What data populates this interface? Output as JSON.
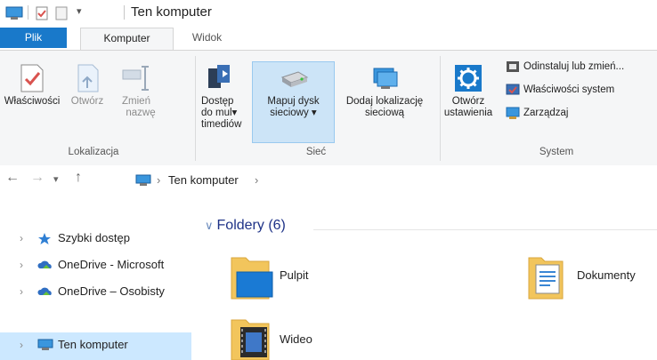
{
  "window": {
    "title": "Ten komputer"
  },
  "tabs": [
    {
      "label": "Plik"
    },
    {
      "label": "Komputer"
    },
    {
      "label": "Widok"
    }
  ],
  "ribbon": {
    "lokalizacja": {
      "group_label": "Lokalizacja",
      "wlasciwosci": "Właściwości",
      "otworz": "Otwórz",
      "zmien_line1": "Zmień",
      "zmien_line2": "nazwę"
    },
    "siec": {
      "group_label": "Sieć",
      "dostep_line1": "Dostęp",
      "dostep_line2": "do mul▾",
      "dostep_line3": "timediów",
      "mapuj_line1": "Mapuj dysk",
      "mapuj_line2": "sieciowy ▾",
      "dodaj_line1": "Dodaj lokalizację",
      "dodaj_line2": "sieciową"
    },
    "system": {
      "group_label": "System",
      "otworz_ust_line1": "Otwórz",
      "otworz_ust_line2": "ustawienia",
      "odinstaluj": "Odinstaluj lub zmień...",
      "wlasciwosci_systemu": "Właściwości system",
      "zarzadzaj": "Zarządzaj"
    }
  },
  "address": {
    "separator": "›",
    "location": "Ten komputer",
    "trailing": "›"
  },
  "nav": [
    {
      "label": "Szybki dostęp"
    },
    {
      "label": "OneDrive - Microsoft"
    },
    {
      "label": "OneDrive – Osobisty"
    },
    {
      "label": "Ten komputer"
    }
  ],
  "content": {
    "group_title": "Foldery (6)",
    "folders": [
      {
        "label": "Pulpit"
      },
      {
        "label": "Dokumenty"
      },
      {
        "label": "Wideo"
      }
    ]
  }
}
